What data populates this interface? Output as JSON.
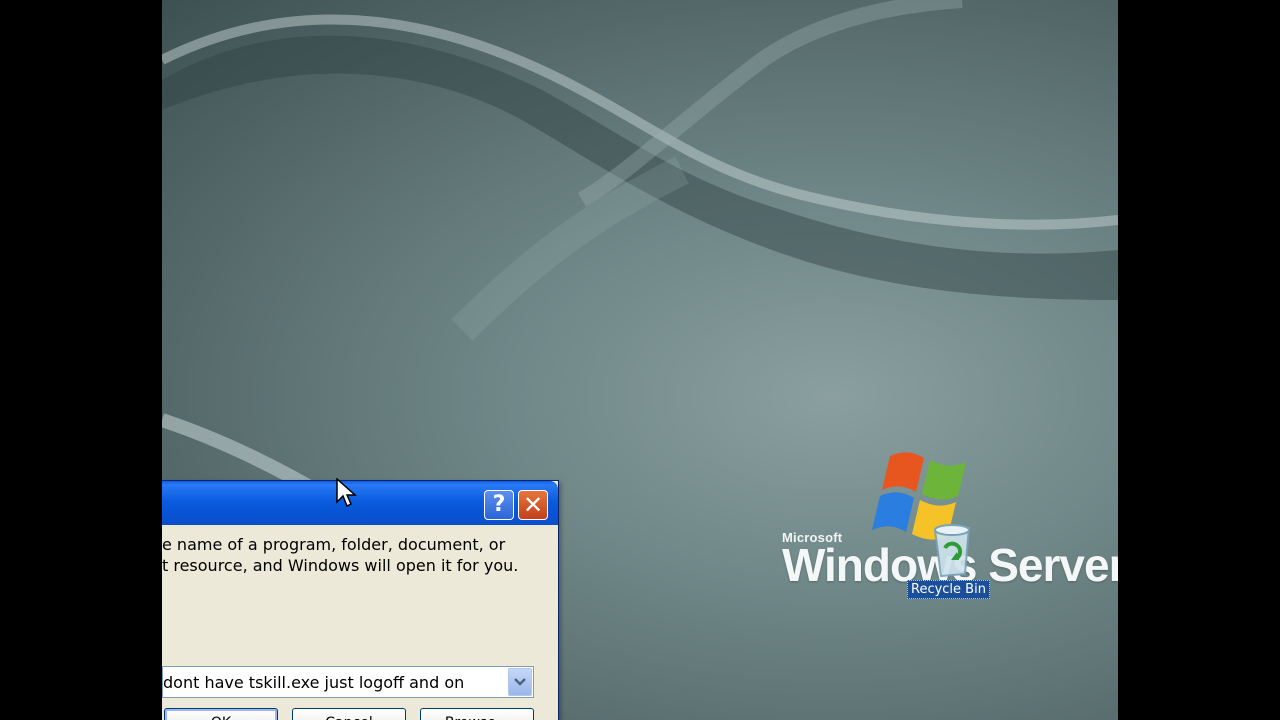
{
  "desktop": {
    "logo": {
      "brand": "Microsoft",
      "product": "Windows Server"
    },
    "icons": [
      {
        "label": "Recycle Bin",
        "icon": "recycle-bin-icon"
      }
    ]
  },
  "run_dialog": {
    "description_line1": "e name of a program, folder, document, or",
    "description_line2": "t resource, and Windows will open it for you.",
    "open_value": "dont have tskill.exe just logoff and on",
    "help_glyph": "?",
    "close_glyph": "✕",
    "buttons": {
      "ok": "OK",
      "cancel": "Cancel",
      "browse": "Browse..."
    }
  },
  "colors": {
    "titlebar": "#0a5ae8",
    "dialog_bg": "#ece9d8",
    "selection": "#1c4f9a"
  }
}
